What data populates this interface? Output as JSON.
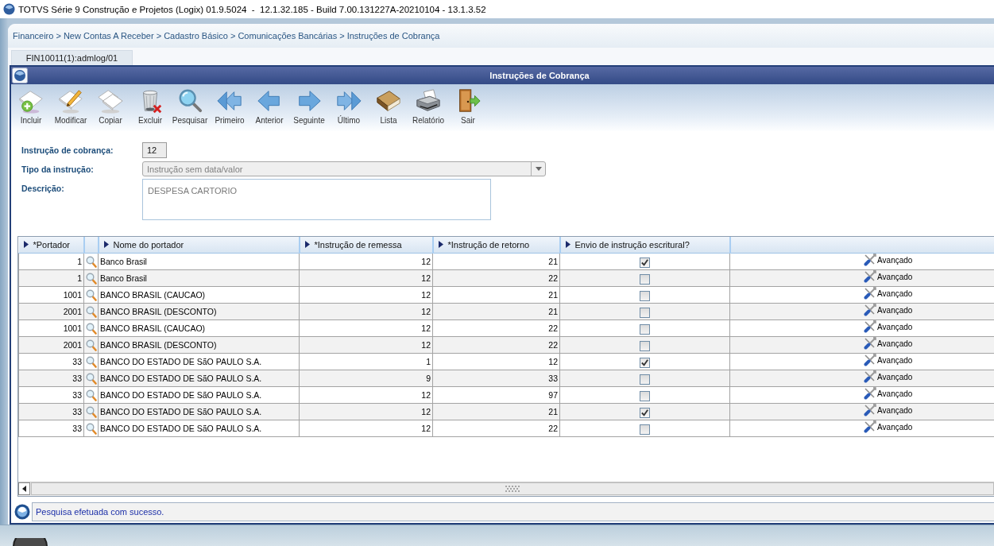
{
  "window": {
    "title": "TOTVS Série 9 Construção e Projetos (Logix) 01.9.5024  -  12.1.32.185 - Build 7.00.131227A-20210104 - 13.1.3.52"
  },
  "breadcrumb": "Financeiro > New Contas A Receber > Cadastro Básico > Comunicações Bancárias > Instruções de Cobrança",
  "tabs": [
    {
      "label": "FIN10011(1):admlog/01",
      "selected": true
    }
  ],
  "form_window": {
    "title": "Instruções de Cobrança",
    "toolbar": [
      {
        "kind": "add",
        "label": "Incluir"
      },
      {
        "kind": "edit",
        "label": "Modificar"
      },
      {
        "kind": "copy",
        "label": "Copiar"
      },
      {
        "kind": "delete",
        "label": "Excluir"
      },
      {
        "kind": "search",
        "label": "Pesquisar"
      },
      {
        "kind": "first",
        "label": "Primeiro"
      },
      {
        "kind": "previous",
        "label": "Anterior"
      },
      {
        "kind": "next",
        "label": "Seguinte"
      },
      {
        "kind": "last",
        "label": "Último"
      },
      {
        "kind": "list",
        "label": "Lista"
      },
      {
        "kind": "report",
        "label": "Relatório"
      },
      {
        "kind": "exit",
        "label": "Sair"
      }
    ],
    "fields": [
      {
        "kind": "text",
        "label": "Instrução de cobrança:",
        "value": "12"
      },
      {
        "kind": "select",
        "label": "Tipo da instrução:",
        "value": "Instrução sem data/valor",
        "disabled": true
      },
      {
        "kind": "textarea",
        "label": "Descrição:",
        "value": "DESPESA CARTORIO",
        "disabled": true
      }
    ],
    "table": {
      "columns": [
        "*Portador",
        "Nome do portador",
        "*Instrução de remessa",
        "*Instrução de retorno",
        "Envio de instrução escritural?"
      ],
      "rows": [
        {
          "portador": "1",
          "nome": "Banco Brasil",
          "remessa": "12",
          "retorno": "21",
          "checked": true,
          "action": "Avançado"
        },
        {
          "portador": "1",
          "nome": "Banco Brasil",
          "remessa": "12",
          "retorno": "22",
          "checked": false,
          "action": "Avançado"
        },
        {
          "portador": "1001",
          "nome": "BANCO BRASIL (CAUCAO)",
          "remessa": "12",
          "retorno": "21",
          "checked": false,
          "action": "Avançado"
        },
        {
          "portador": "2001",
          "nome": "BANCO BRASIL (DESCONTO)",
          "remessa": "12",
          "retorno": "21",
          "checked": false,
          "action": "Avançado"
        },
        {
          "portador": "1001",
          "nome": "BANCO BRASIL (CAUCAO)",
          "remessa": "12",
          "retorno": "22",
          "checked": false,
          "action": "Avançado"
        },
        {
          "portador": "2001",
          "nome": "BANCO BRASIL (DESCONTO)",
          "remessa": "12",
          "retorno": "22",
          "checked": false,
          "action": "Avançado"
        },
        {
          "portador": "33",
          "nome": "BANCO DO ESTADO DE SãO PAULO S.A.",
          "remessa": "1",
          "retorno": "12",
          "checked": true,
          "action": "Avançado"
        },
        {
          "portador": "33",
          "nome": "BANCO DO ESTADO DE SãO PAULO S.A.",
          "remessa": "9",
          "retorno": "33",
          "checked": false,
          "action": "Avançado"
        },
        {
          "portador": "33",
          "nome": "BANCO DO ESTADO DE SãO PAULO S.A.",
          "remessa": "12",
          "retorno": "97",
          "checked": false,
          "action": "Avançado"
        },
        {
          "portador": "33",
          "nome": "BANCO DO ESTADO DE SãO PAULO S.A.",
          "remessa": "12",
          "retorno": "21",
          "checked": true,
          "action": "Avançado"
        },
        {
          "portador": "33",
          "nome": "BANCO DO ESTADO DE SãO PAULO S.A.",
          "remessa": "12",
          "retorno": "22",
          "checked": false,
          "action": "Avançado"
        }
      ]
    },
    "status_bar": {
      "message": "Pesquisa efetuada com sucesso."
    }
  }
}
